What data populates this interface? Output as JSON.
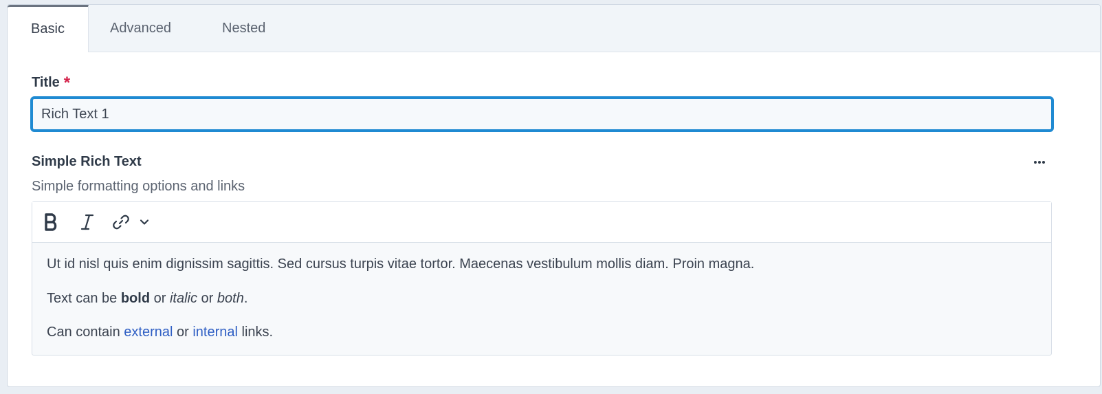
{
  "tabs": [
    {
      "label": "Basic",
      "active": true
    },
    {
      "label": "Advanced",
      "active": false
    },
    {
      "label": "Nested",
      "active": false
    }
  ],
  "title_field": {
    "label": "Title",
    "required_marker": "*",
    "value": "Rich Text 1"
  },
  "rich_text_field": {
    "label": "Simple Rich Text",
    "help_text": "Simple formatting options and links",
    "more_icon": "ellipsis-icon",
    "toolbar": {
      "bold_icon": "bold-icon",
      "italic_icon": "italic-icon",
      "link_icon": "link-icon",
      "dropdown_icon": "chevron-down-icon"
    },
    "paragraphs": {
      "p1": "Ut id nisl quis enim dignissim sagittis. Sed cursus turpis vitae tortor. Maecenas vestibulum mollis diam. Proin magna.",
      "p2": {
        "prefix": "Text can be ",
        "bold": "bold",
        "mid1": " or ",
        "italic": "italic",
        "mid2": " or ",
        "both": "both",
        "suffix": "."
      },
      "p3": {
        "prefix": "Can contain ",
        "link1": "external",
        "mid": " or ",
        "link2": "internal",
        "suffix": " links."
      }
    }
  },
  "colors": {
    "focus_border": "#1f8ad2",
    "required": "#d4224a",
    "link": "#2f5fc4"
  }
}
